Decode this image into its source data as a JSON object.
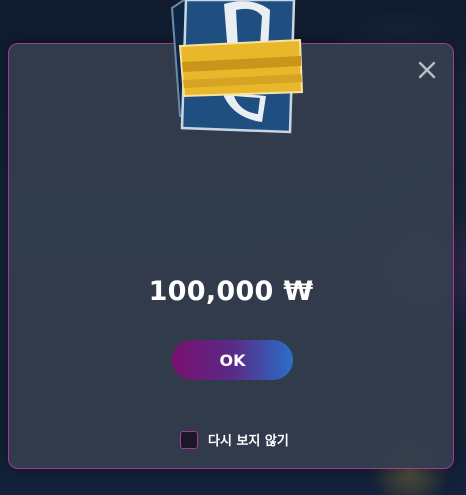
{
  "popup": {
    "amount": "100,000 ₩",
    "ok_label": "OK",
    "dont_show_again_label": "다시 보지 않기",
    "dont_show_again_checked": false,
    "close_icon": "close-icon",
    "reward_icon": "ticket-icon"
  },
  "colors": {
    "border_accent": "#a13a9c",
    "button_gradient_start": "#7a0f6f",
    "button_gradient_end": "#2a6fc8",
    "ticket_blue": "#1e4f7f",
    "ticket_band": "#e8b82a"
  }
}
